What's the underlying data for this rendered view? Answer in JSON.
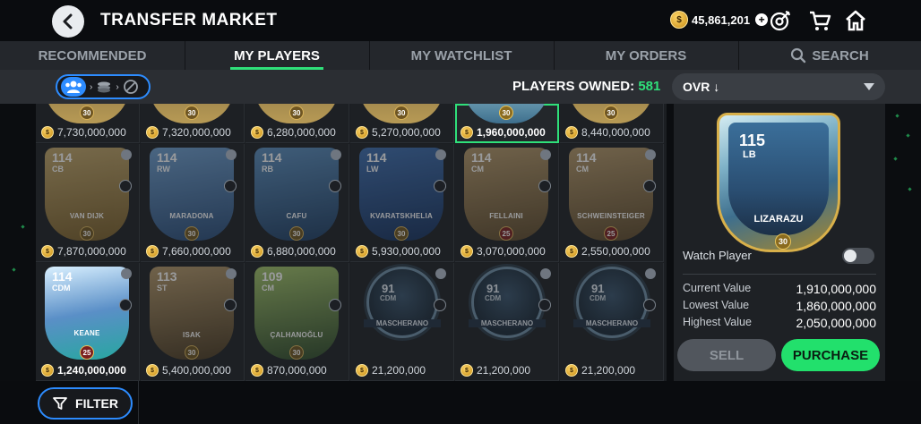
{
  "header": {
    "title": "TRANSFER MARKET",
    "coins": "45,861,201"
  },
  "tabs": [
    {
      "label": "RECOMMENDED",
      "active": false
    },
    {
      "label": "MY PLAYERS",
      "active": true
    },
    {
      "label": "MY WATCHLIST",
      "active": false
    },
    {
      "label": "MY ORDERS",
      "active": false
    },
    {
      "label": "SEARCH",
      "active": false
    }
  ],
  "filterbar": {
    "owned_label": "PLAYERS OWNED:",
    "owned_count": "581",
    "sort_label": "OVR ↓"
  },
  "grid": {
    "row0": [
      {
        "price": "7,730,000,000",
        "level": "30"
      },
      {
        "price": "7,320,000,000",
        "level": "30"
      },
      {
        "price": "6,280,000,000",
        "level": "30"
      },
      {
        "price": "5,270,000,000",
        "level": "30"
      },
      {
        "price": "1,960,000,000",
        "level": "30",
        "selected": true
      },
      {
        "price": "8,440,000,000",
        "level": "30"
      }
    ],
    "row1": [
      {
        "ovr": "114",
        "pos": "CB",
        "name": "VAN DIJK",
        "level": "30",
        "price": "7,870,000,000"
      },
      {
        "ovr": "114",
        "pos": "RW",
        "name": "MARADONA",
        "level": "30",
        "price": "7,660,000,000"
      },
      {
        "ovr": "114",
        "pos": "RB",
        "name": "CAFU",
        "level": "30",
        "price": "6,880,000,000"
      },
      {
        "ovr": "114",
        "pos": "LW",
        "name": "KVARATSKHELIA",
        "level": "30",
        "price": "5,930,000,000"
      },
      {
        "ovr": "114",
        "pos": "CM",
        "name": "FELLAINI",
        "level": "25",
        "price": "3,070,000,000"
      },
      {
        "ovr": "114",
        "pos": "CM",
        "name": "SCHWEINSTEIGER",
        "level": "25",
        "price": "2,550,000,000"
      }
    ],
    "row2": [
      {
        "ovr": "114",
        "pos": "CDM",
        "name": "KEANE",
        "level": "25",
        "price": "1,240,000,000"
      },
      {
        "ovr": "113",
        "pos": "ST",
        "name": "ISAK",
        "level": "30",
        "price": "5,400,000,000"
      },
      {
        "ovr": "109",
        "pos": "CM",
        "name": "ÇALHANOĞLU",
        "level": "30",
        "price": "870,000,000"
      },
      {
        "ovr": "91",
        "pos": "CDM",
        "name": "MASCHERANO",
        "price": "21,200,000"
      },
      {
        "ovr": "91",
        "pos": "CDM",
        "name": "MASCHERANO",
        "price": "21,200,000"
      },
      {
        "ovr": "91",
        "pos": "CDM",
        "name": "MASCHERANO",
        "price": "21,200,000"
      }
    ]
  },
  "panel": {
    "ovr": "115",
    "pos": "LB",
    "name": "LIZARAZU",
    "level": "30",
    "watch_label": "Watch Player",
    "current_label": "Current Value",
    "current_value": "1,910,000,000",
    "lowest_label": "Lowest Value",
    "lowest_value": "1,860,000,000",
    "highest_label": "Highest Value",
    "highest_value": "2,050,000,000",
    "sell_label": "SELL",
    "purchase_label": "PURCHASE"
  },
  "bottom": {
    "filter_label": "FILTER"
  },
  "colors": {
    "accent_green": "#22e06c",
    "accent_blue": "#2d8cff",
    "coin_gold": "#f2b527"
  }
}
